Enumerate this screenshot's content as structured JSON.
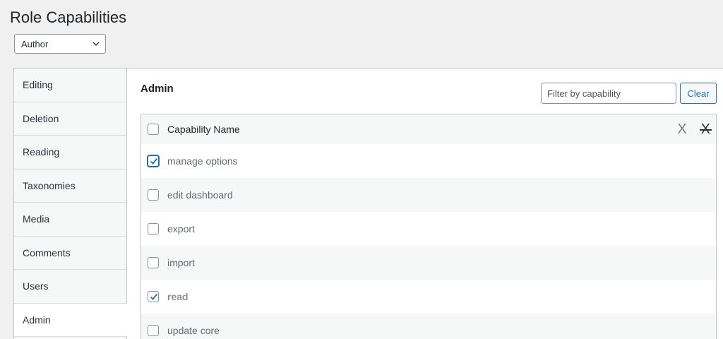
{
  "page": {
    "title": "Role Capabilities"
  },
  "role_select": {
    "value": "Author"
  },
  "tabs": [
    {
      "label": "Editing"
    },
    {
      "label": "Deletion"
    },
    {
      "label": "Reading"
    },
    {
      "label": "Taxonomies"
    },
    {
      "label": "Media"
    },
    {
      "label": "Comments"
    },
    {
      "label": "Users"
    },
    {
      "label": "Admin",
      "active": true
    }
  ],
  "section": {
    "title": "Admin",
    "filter_placeholder": "Filter by capability",
    "clear_label": "Clear"
  },
  "table": {
    "header": "Capability Name",
    "header_icons": [
      "X",
      "X"
    ],
    "rows": [
      {
        "name": "manage options",
        "checked": true
      },
      {
        "name": "edit dashboard",
        "checked": false
      },
      {
        "name": "export",
        "checked": false
      },
      {
        "name": "import",
        "checked": false
      },
      {
        "name": "read",
        "checked": true
      },
      {
        "name": "update core",
        "checked": false
      }
    ]
  },
  "colors": {
    "accent": "#2271b1",
    "background": "#f0f0f1"
  }
}
